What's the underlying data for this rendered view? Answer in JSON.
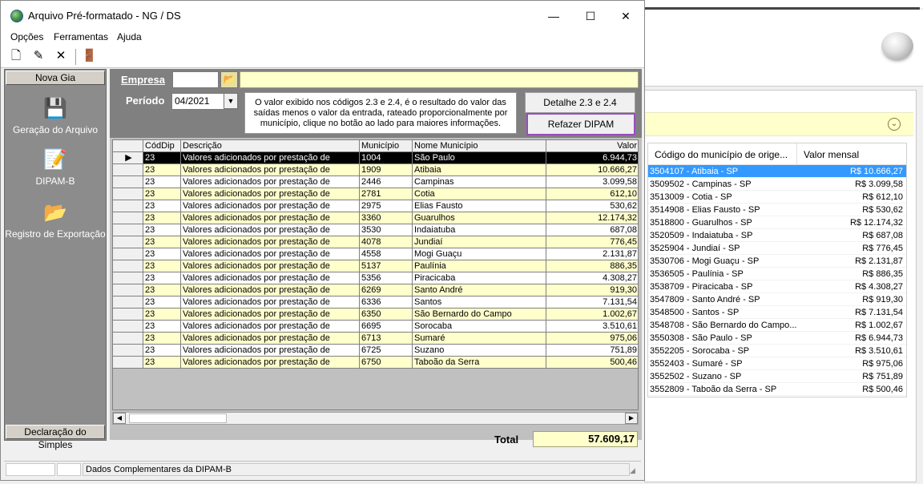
{
  "window": {
    "title": "Arquivo Pré-formatado - NG / DS",
    "minimize": "—",
    "maximize": "☐",
    "close": "✕"
  },
  "menu": [
    "Opções",
    "Ferramentas",
    "Ajuda"
  ],
  "toolbar": {
    "icons": [
      "new-document-icon",
      "edit-document-icon",
      "delete-icon",
      "exit-door-icon"
    ]
  },
  "sidebar": {
    "header": "Nova Gia",
    "items": [
      {
        "label": "Geração do Arquivo",
        "icon": "disk-wizard-icon"
      },
      {
        "label": "DIPAM-B",
        "icon": "document-pen-icon"
      },
      {
        "label": "Registro de Exportação",
        "icon": "export-folder-icon"
      }
    ],
    "footer": "Declaração do Simples"
  },
  "form": {
    "empresa_label": "Empresa",
    "empresa_value": "",
    "periodo_label": "Período",
    "periodo_value": "04/2021",
    "info_text": "O valor exibido nos códigos 2.3 e 2.4, é o resultado do valor das saídas menos o valor da entrada, rateado proporcionalmente por município, clique no botão ao lado para maiores informações.",
    "btn_detalhe": "Detalhe 2.3 e 2.4",
    "btn_refazer": "Refazer DIPAM"
  },
  "grid": {
    "columns": [
      "CódDip",
      "Descrição",
      "Município",
      "Nome Município",
      "Valor"
    ],
    "rows": [
      [
        "23",
        "Valores adicionados por prestação de",
        "1004",
        "São Paulo",
        "6.944,73"
      ],
      [
        "23",
        "Valores adicionados por prestação de",
        "1909",
        "Atibaia",
        "10.666,27"
      ],
      [
        "23",
        "Valores adicionados por prestação de",
        "2446",
        "Campinas",
        "3.099,58"
      ],
      [
        "23",
        "Valores adicionados por prestação de",
        "2781",
        "Cotia",
        "612,10"
      ],
      [
        "23",
        "Valores adicionados por prestação de",
        "2975",
        "Elias Fausto",
        "530,62"
      ],
      [
        "23",
        "Valores adicionados por prestação de",
        "3360",
        "Guarulhos",
        "12.174,32"
      ],
      [
        "23",
        "Valores adicionados por prestação de",
        "3530",
        "Indaiatuba",
        "687,08"
      ],
      [
        "23",
        "Valores adicionados por prestação de",
        "4078",
        "Jundiaí",
        "776,45"
      ],
      [
        "23",
        "Valores adicionados por prestação de",
        "4558",
        "Mogi Guaçu",
        "2.131,87"
      ],
      [
        "23",
        "Valores adicionados por prestação de",
        "5137",
        "Paulínia",
        "886,35"
      ],
      [
        "23",
        "Valores adicionados por prestação de",
        "5356",
        "Piracicaba",
        "4.308,27"
      ],
      [
        "23",
        "Valores adicionados por prestação de",
        "6269",
        "Santo André",
        "919,30"
      ],
      [
        "23",
        "Valores adicionados por prestação de",
        "6336",
        "Santos",
        "7.131,54"
      ],
      [
        "23",
        "Valores adicionados por prestação de",
        "6350",
        "São Bernardo do Campo",
        "1.002,67"
      ],
      [
        "23",
        "Valores adicionados por prestação de",
        "6695",
        "Sorocaba",
        "3.510,61"
      ],
      [
        "23",
        "Valores adicionados por prestação de",
        "6713",
        "Sumaré",
        "975,06"
      ],
      [
        "23",
        "Valores adicionados por prestação de",
        "6725",
        "Suzano",
        "751,89"
      ],
      [
        "23",
        "Valores adicionados por prestação de",
        "6750",
        "Taboão da Serra",
        "500,46"
      ]
    ],
    "selected_marker": "▶"
  },
  "total": {
    "label": "Total",
    "value": "57.609,17"
  },
  "statusbar": {
    "text": "Dados Complementares da DIPAM-B"
  },
  "background_panel": {
    "columns": [
      "Código do município de orige...",
      "Valor mensal"
    ],
    "rows": [
      [
        "3504107 - Atibaia - SP",
        "R$ 10.666,27"
      ],
      [
        "3509502 - Campinas - SP",
        "R$ 3.099,58"
      ],
      [
        "3513009 - Cotia - SP",
        "R$ 612,10"
      ],
      [
        "3514908 - Elias Fausto - SP",
        "R$ 530,62"
      ],
      [
        "3518800 - Guarulhos - SP",
        "R$ 12.174,32"
      ],
      [
        "3520509 - Indaiatuba - SP",
        "R$ 687,08"
      ],
      [
        "3525904 - Jundiaí - SP",
        "R$ 776,45"
      ],
      [
        "3530706 - Mogi Guaçu - SP",
        "R$ 2.131,87"
      ],
      [
        "3536505 - Paulínia - SP",
        "R$ 886,35"
      ],
      [
        "3538709 - Piracicaba - SP",
        "R$ 4.308,27"
      ],
      [
        "3547809 - Santo André - SP",
        "R$ 919,30"
      ],
      [
        "3548500 - Santos - SP",
        "R$ 7.131,54"
      ],
      [
        "3548708 - São Bernardo do Campo...",
        "R$ 1.002,67"
      ],
      [
        "3550308 - São Paulo - SP",
        "R$ 6.944,73"
      ],
      [
        "3552205 - Sorocaba - SP",
        "R$ 3.510,61"
      ],
      [
        "3552403 - Sumaré - SP",
        "R$ 975,06"
      ],
      [
        "3552502 - Suzano - SP",
        "R$ 751,89"
      ],
      [
        "3552809 - Taboão da Serra - SP",
        "R$ 500,46"
      ]
    ]
  }
}
